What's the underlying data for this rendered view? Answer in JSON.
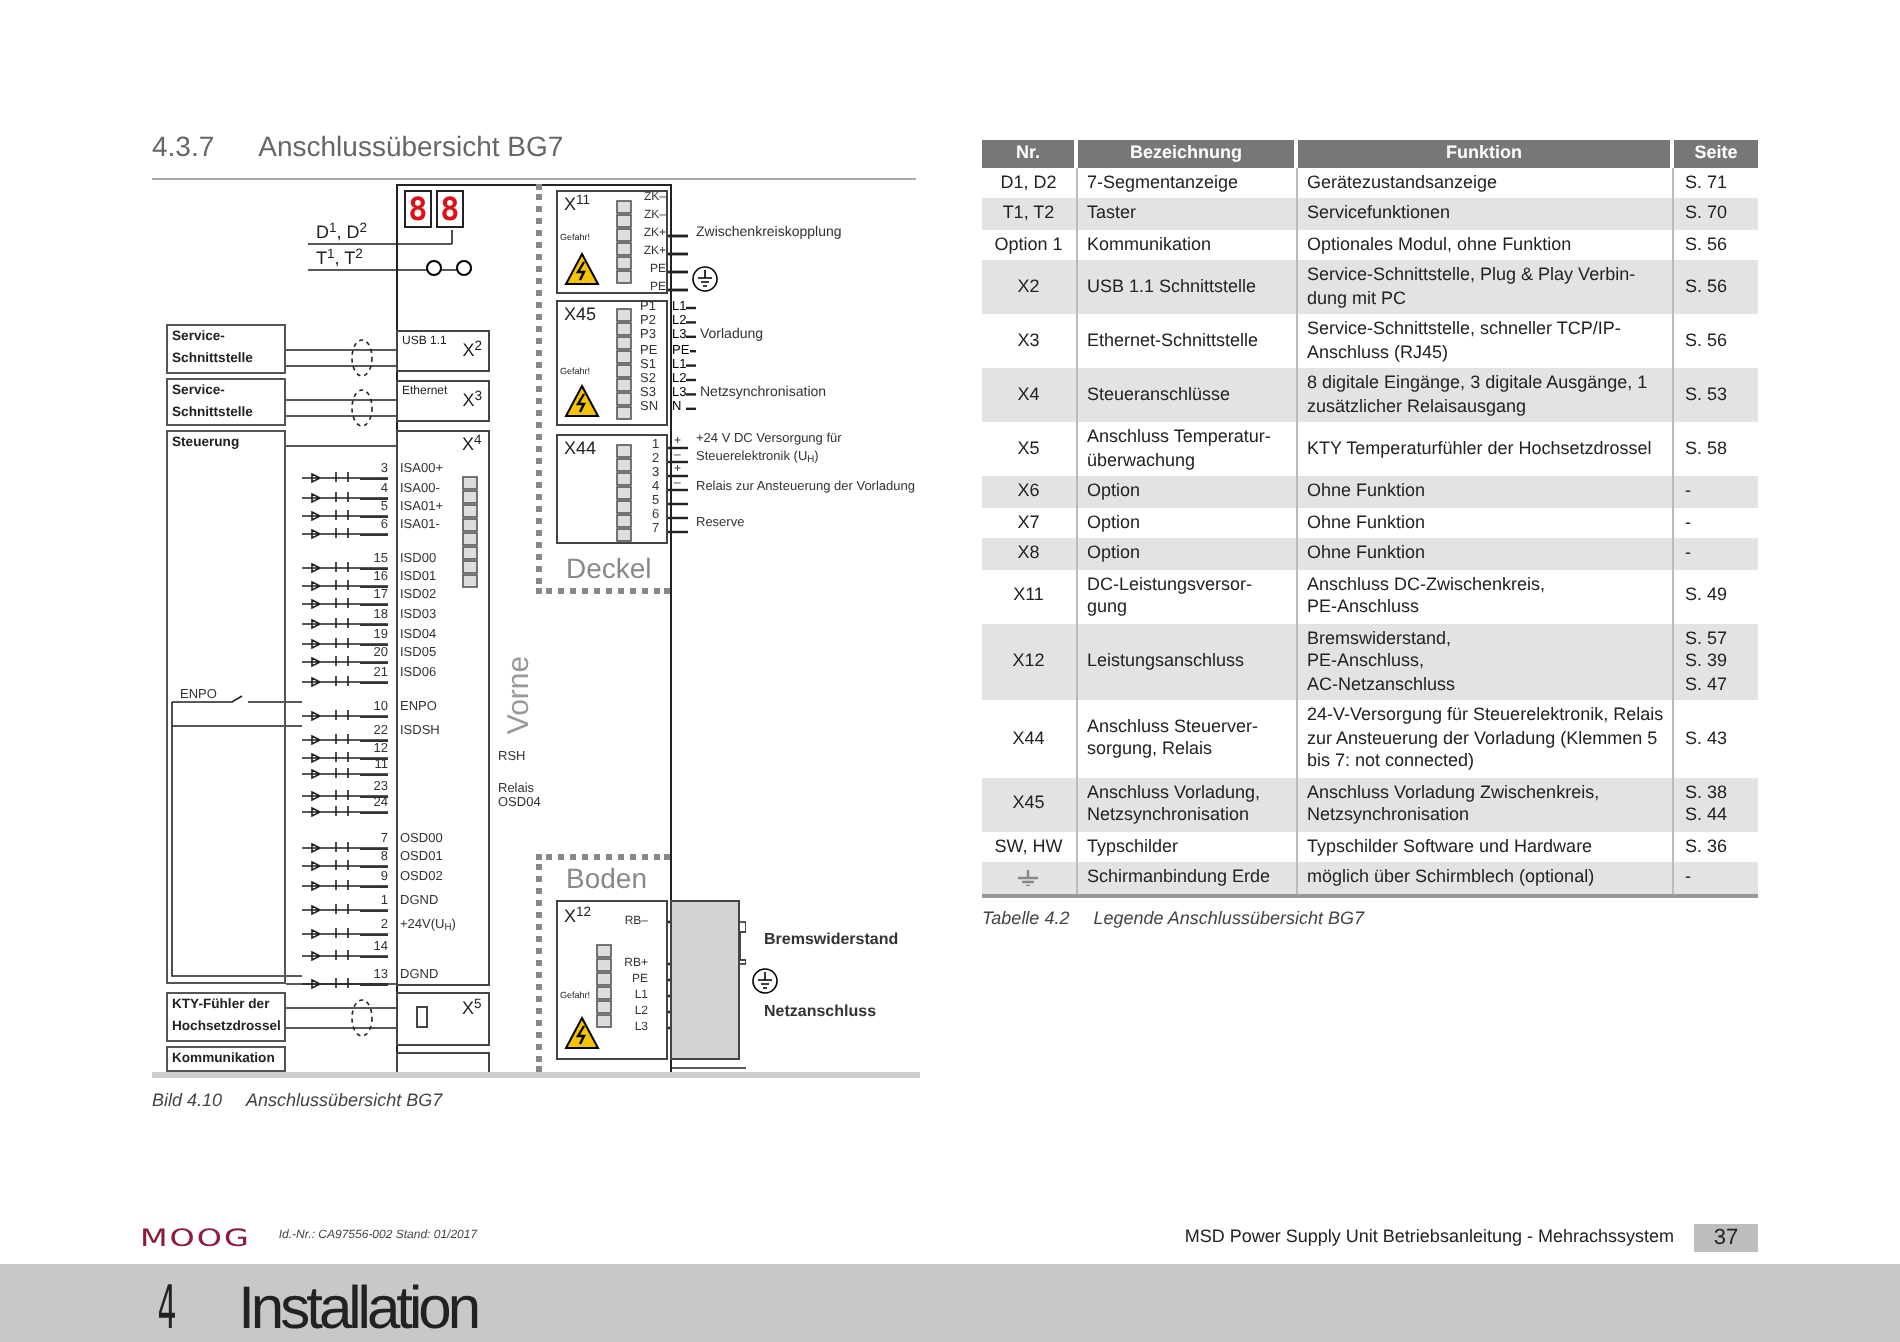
{
  "heading": {
    "number": "4.3.7",
    "title": "Anschlussübersicht BG7"
  },
  "diagram": {
    "display": {
      "digits": [
        "8",
        "8"
      ],
      "d_label": "D$^{1}$, D$^{2}$",
      "t_label": "T$^{1}$, T$^{2}$"
    },
    "external": [
      {
        "label": "Service-Schnittstelle"
      },
      {
        "label": "Service-Schnittstelle"
      },
      {
        "label": "Steuerung"
      },
      {
        "label": "KTY-Fühler der Hochsetzdrossel"
      },
      {
        "label": "Kommunikation"
      }
    ],
    "ports": [
      {
        "name": "USB 1.1",
        "x": "X$^{2}$"
      },
      {
        "name": "Ethernet",
        "x": "X$^{3}$"
      }
    ],
    "x4": {
      "x": "X$^{4}$",
      "enpo": "ENPO",
      "pins": [
        {
          "num": "3",
          "name": "ISA00+"
        },
        {
          "num": "4",
          "name": "ISA00-"
        },
        {
          "num": "5",
          "name": "ISA01+"
        },
        {
          "num": "6",
          "name": "ISA01-"
        },
        {
          "num": "15",
          "name": "ISD00"
        },
        {
          "num": "16",
          "name": "ISD01"
        },
        {
          "num": "17",
          "name": "ISD02"
        },
        {
          "num": "18",
          "name": "ISD03"
        },
        {
          "num": "19",
          "name": "ISD04"
        },
        {
          "num": "20",
          "name": "ISD05"
        },
        {
          "num": "21",
          "name": "ISD06"
        },
        {
          "num": "10",
          "name": "ENPO"
        },
        {
          "num": "22",
          "name": "ISDSH"
        },
        {
          "num": "12"
        },
        {
          "num": "11"
        },
        {
          "num": "23"
        },
        {
          "num": "24"
        },
        {
          "num": "7",
          "name": "OSD00"
        },
        {
          "num": "8",
          "name": "OSD01"
        },
        {
          "num": "9",
          "name": "OSD02"
        },
        {
          "num": "1",
          "name": "DGND"
        },
        {
          "num": "2",
          "name": "+24V(U$_{H}$)"
        },
        {
          "num": "14"
        },
        {
          "num": "13",
          "name": "DGND"
        }
      ],
      "side_labels": [
        "RSH",
        "Relais OSD04"
      ]
    },
    "x5": {
      "x": "X$^{5}$"
    },
    "vorne": "Vorne",
    "deckel": {
      "label": "Deckel",
      "x11": {
        "x": "X$^{11}$",
        "warning": "Gefahr!",
        "pins": [
          "ZK–",
          "ZK–",
          "ZK+",
          "ZK+",
          "PE",
          "PE"
        ],
        "label": "Zwischenkreiskopplung"
      },
      "x45": {
        "x": "X45",
        "warning": "Gefahr!",
        "pins": [
          {
            "name": "P1",
            "line": "L1"
          },
          {
            "name": "P2",
            "line": "L2"
          },
          {
            "name": "P3",
            "line": "L3"
          },
          {
            "name": "PE",
            "line": "PE"
          },
          {
            "name": "S1",
            "line": "L1"
          },
          {
            "name": "S2",
            "line": "L2"
          },
          {
            "name": "S3",
            "line": "L3"
          },
          {
            "name": "SN",
            "line": "N"
          }
        ],
        "labels": [
          "Vorladung",
          "Netzsynchronisation"
        ]
      },
      "x44": {
        "x": "X44",
        "pins": [
          {
            "num": "1",
            "sign": "+"
          },
          {
            "num": "2",
            "sign": "–"
          },
          {
            "num": "3",
            "sign": "+"
          },
          {
            "num": "4",
            "sign": "–"
          },
          {
            "num": "5"
          },
          {
            "num": "6"
          },
          {
            "num": "7"
          }
        ],
        "labels": [
          "+24 V DC Versorgung für",
          "Steuerelektronik (U$_{H}$)",
          "Relais zur Ansteuerung der Vorladung",
          "Reserve"
        ]
      }
    },
    "boden": {
      "label": "Boden",
      "x12": {
        "x": "X$^{12}$",
        "warning": "Gefahr!",
        "pins": [
          "RB–",
          "RB+",
          "PE",
          "L1",
          "L2",
          "L3"
        ],
        "labels": [
          "Bremswiderstand",
          "Netzanschluss"
        ]
      }
    },
    "caption": {
      "number": "Bild 4.10",
      "title": "Anschlussübersicht BG7"
    }
  },
  "table": {
    "columns": [
      "Nr.",
      "Bezeichnung",
      "Funktion",
      "Seite"
    ],
    "rows": [
      {
        "kind": "text",
        "nr": "D1, D2",
        "name": "7-Segmentanzeige",
        "function": "Gerätezustandsanzeige",
        "pages": [
          "S. 71"
        ]
      },
      {
        "kind": "text",
        "nr": "T1, T2",
        "name": "Taster",
        "function": "Servicefunktionen",
        "pages": [
          "S. 70"
        ]
      },
      {
        "kind": "text",
        "nr": "Option 1",
        "name": "Kommunikation",
        "function": "Optionales Modul, ohne Funktion",
        "pages": [
          "S. 56"
        ]
      },
      {
        "kind": "text",
        "nr": "X2",
        "name": "USB 1.1 Schnittstelle",
        "function": "Service-Schnittstelle, Plug & Play Verbin-\ndung mit PC",
        "pages": [
          "S. 56"
        ]
      },
      {
        "kind": "text",
        "nr": "X3",
        "name": "Ethernet-Schnittstelle",
        "function": "Service-Schnittstelle, schneller TCP/IP-\nAnschluss (RJ45)",
        "pages": [
          "S. 56"
        ]
      },
      {
        "kind": "text",
        "nr": "X4",
        "name": "Steueranschlüsse",
        "function": "8 digitale Eingänge, 3 digitale Ausgänge, 1\nzusätzlicher Relaisausgang",
        "pages": [
          "S. 53"
        ]
      },
      {
        "kind": "text",
        "nr": "X5",
        "name": "Anschluss Temperatur-\nüberwachung",
        "function": "KTY Temperaturfühler der Hochsetzdrossel",
        "pages": [
          "S. 58"
        ]
      },
      {
        "kind": "text",
        "nr": "X6",
        "name": "Option",
        "function": "Ohne Funktion",
        "pages": [
          "-"
        ]
      },
      {
        "kind": "text",
        "nr": "X7",
        "name": "Option",
        "function": "Ohne Funktion",
        "pages": [
          "-"
        ]
      },
      {
        "kind": "text",
        "nr": "X8",
        "name": "Option",
        "function": "Ohne Funktion",
        "pages": [
          "-"
        ]
      },
      {
        "kind": "text",
        "nr": "X11",
        "name": "DC-Leistungsversor-\ngung",
        "function": "Anschluss DC-Zwischenkreis,\nPE-Anschluss",
        "pages": [
          "S. 49"
        ]
      },
      {
        "kind": "text",
        "nr": "X12",
        "name": "Leistungsanschluss",
        "function": "Bremswiderstand,\nPE-Anschluss,\nAC-Netzanschluss",
        "pages": [
          "S. 57",
          "S. 39",
          "S. 47"
        ]
      },
      {
        "kind": "text",
        "nr": "X44",
        "name": "Anschluss Steuerver-\nsorgung, Relais",
        "function": "24-V-Versorgung für Steuerelektronik, Relais\nzur Ansteuerung der Vorladung (Klemmen 5\nbis 7: not connected)",
        "pages": [
          "S. 43"
        ]
      },
      {
        "kind": "text",
        "nr": "X45",
        "name": "Anschluss Vorladung,\nNetzsynchronisation",
        "function": "Anschluss Vorladung Zwischenkreis,\nNetzsynchronisation",
        "pages": [
          "S. 38",
          "S. 44"
        ]
      },
      {
        "kind": "text",
        "nr": "SW, HW",
        "name": "Typschilder",
        "function": "Typschilder Software und Hardware",
        "pages": [
          "S. 36"
        ]
      },
      {
        "kind": "ground",
        "name": "Schirmanbindung Erde",
        "function": "möglich über Schirmblech (optional)",
        "pages": [
          "-"
        ]
      }
    ],
    "caption": {
      "number": "Tabelle 4.2",
      "title": "Legende Anschlussübersicht BG7"
    }
  },
  "footer": {
    "logo": "MOOG",
    "doc_id": "Id.-Nr.: CA97556-002 Stand: 01/2017",
    "title": "MSD Power Supply Unit Betriebsanleitung - Mehrachssystem",
    "page": "37"
  },
  "chapter": {
    "number": "4",
    "title": "Installation"
  }
}
